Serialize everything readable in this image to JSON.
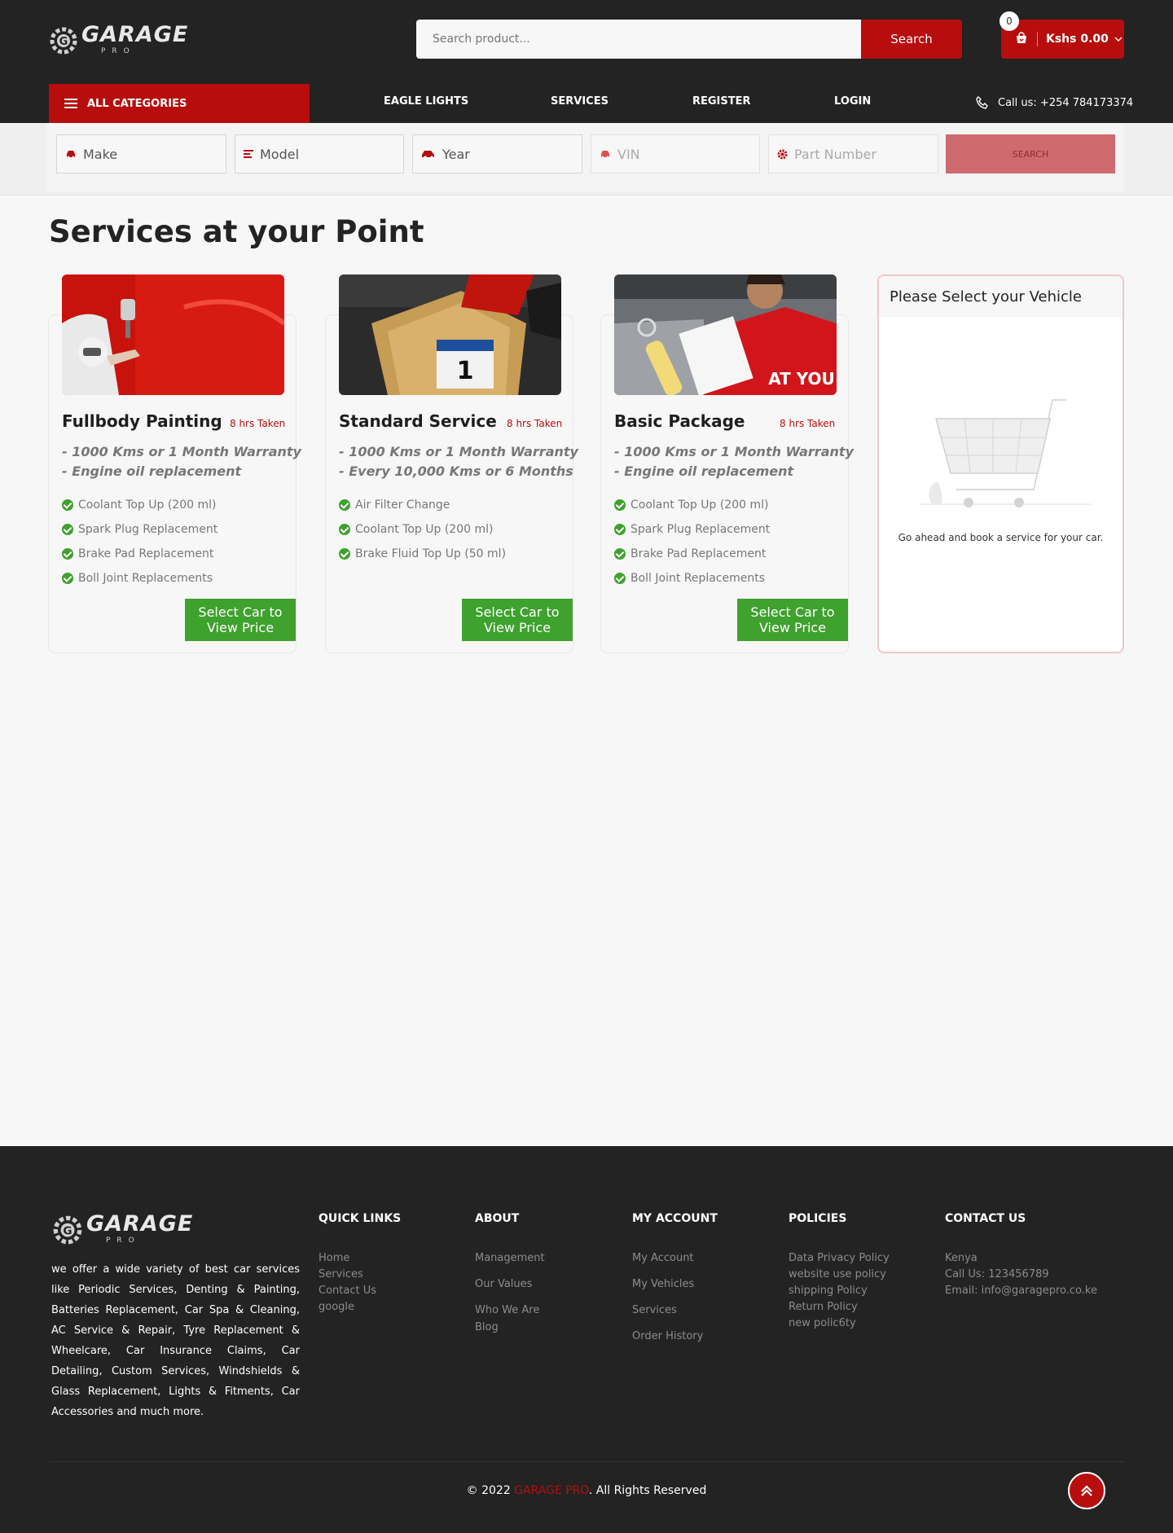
{
  "header": {
    "logo_text": "GARAGE",
    "logo_sub": "PRO",
    "search_placeholder": "Search product...",
    "search_label": "Search",
    "cart_count": "0",
    "cart_total": "Kshs 0.00",
    "categories_label": "ALL CATEGORIES",
    "nav": [
      "EAGLE LIGHTS",
      "SERVICES",
      "REGISTER",
      "LOGIN"
    ],
    "call": "Call us: +254 784173374",
    "accent": "#b80d0d"
  },
  "filters": {
    "make": "Make",
    "model": "Model",
    "year": "Year",
    "vin": "VIN",
    "part_number": "Part Number",
    "search_label": "SEARCH"
  },
  "main": {
    "title": "Services at your Point",
    "cards": [
      {
        "title": "Fullbody Painting",
        "hrs": "8 hrs Taken",
        "warranty": [
          "- 1000 Kms or 1 Month Warranty",
          "- Engine oil replacement"
        ],
        "items": [
          "Coolant Top Up (200 ml)",
          "Spark Plug Replacement",
          "Brake Pad Replacement",
          "Boll Joint Replacements"
        ],
        "button": "Select Car to View Price"
      },
      {
        "title": "Standard Service",
        "hrs": "8 hrs Taken",
        "warranty": [
          "- 1000 Kms or 1 Month Warranty",
          "- Every 10,000 Kms or 6 Months"
        ],
        "items": [
          "Air Filter Change",
          "Coolant Top Up (200 ml)",
          "Brake Fluid Top Up (50 ml)"
        ],
        "button": "Select Car to View Price"
      },
      {
        "title": "Basic Package",
        "hrs": "8 hrs Taken",
        "warranty": [
          "- 1000 Kms or 1 Month Warranty",
          "- Engine oil replacement"
        ],
        "items": [
          "Coolant Top Up (200 ml)",
          "Spark Plug Replacement",
          "Brake Pad Replacement",
          "Boll Joint Replacements"
        ],
        "button": "Select Car to View Price"
      }
    ],
    "vehicle_panel": {
      "title": "Please Select your Vehicle",
      "message": "Go ahead and book a service for your car."
    }
  },
  "footer": {
    "about": "we offer a wide variety of best car services like Periodic Services, Denting & Painting, Batteries Replacement, Car Spa & Cleaning, AC Service & Repair, Tyre Replacement & Wheelcare, Car Insurance Claims, Car Detailing, Custom Services, Windshields & Glass Replacement, Lights & Fitments, Car Accessories and much more.",
    "quick_links": {
      "title": "QUICK LINKS",
      "items": [
        "Home",
        "Services",
        "Contact Us",
        "google"
      ]
    },
    "about_col": {
      "title": "ABOUT",
      "items": [
        "Management",
        "Our Values",
        "Who We Are",
        "Blog"
      ]
    },
    "my_account": {
      "title": "MY ACCOUNT",
      "items": [
        "My Account",
        "My Vehicles",
        "Services",
        "Order History"
      ]
    },
    "policies": {
      "title": "POLICIES",
      "items": [
        "Data Privacy Policy",
        "website use policy",
        "shipping Policy",
        "Return Policy",
        "new polic6ty"
      ]
    },
    "contact": {
      "title": "CONTACT US",
      "items": [
        "Kenya",
        "Call Us: 123456789",
        "Email: info@garagepro.co.ke"
      ]
    },
    "copyright_prefix": "© 2022 ",
    "copyright_brand": "GARAGE PRO",
    "copyright_suffix": ". All Rights Reserved"
  }
}
